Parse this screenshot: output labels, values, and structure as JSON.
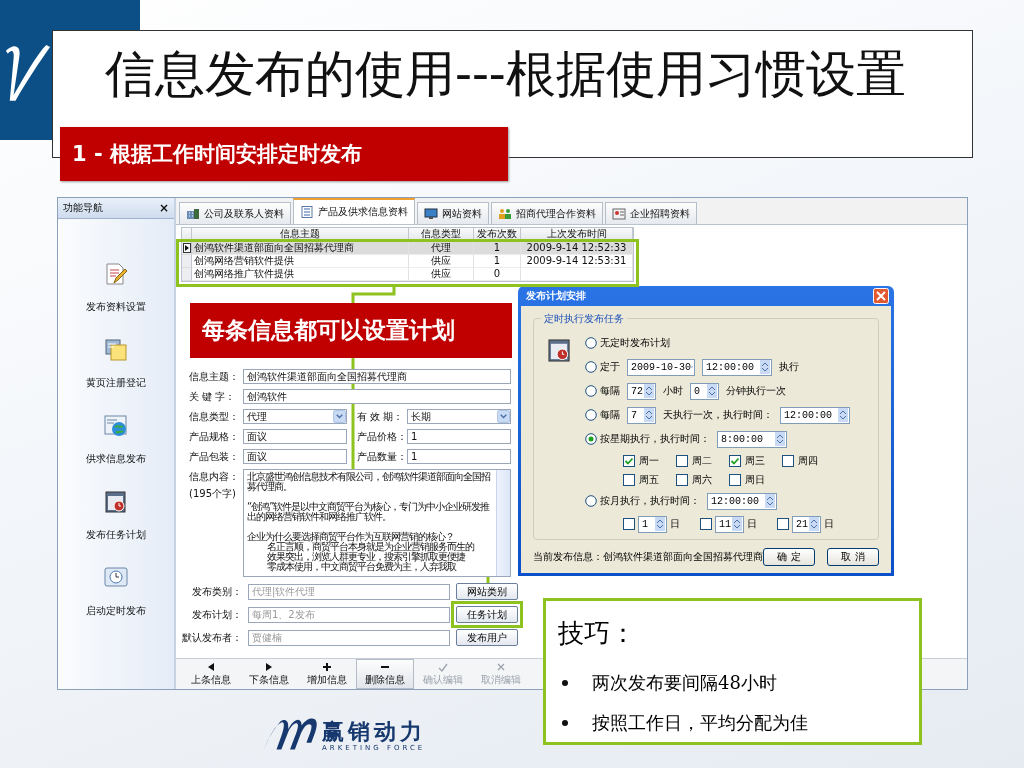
{
  "slide": {
    "title": "信息发布的使用---根据使用习惯设置",
    "section": "1 - 根据工作时间安排定时发布",
    "callout": "每条信息都可以设置计划",
    "tips": {
      "heading": "技巧：",
      "items": [
        "两次发布要间隔48小时",
        "按照工作日，平均分配为佳"
      ]
    },
    "logo": {
      "name": "赢销动力",
      "tagline": "ARKETING FORCE"
    }
  },
  "app": {
    "nav": {
      "title": "功能导航",
      "close": "×",
      "items": [
        {
          "label": "发布资料设置"
        },
        {
          "label": "黄页注册登记"
        },
        {
          "label": "供求信息发布"
        },
        {
          "label": "发布任务计划"
        },
        {
          "label": "启动定时发布"
        }
      ]
    },
    "tabs": [
      {
        "label": "公司及联系人资料",
        "selected": false
      },
      {
        "label": "产品及供求信息资料",
        "selected": true
      },
      {
        "label": "网站资料",
        "selected": false
      },
      {
        "label": "招商代理合作资料",
        "selected": false
      },
      {
        "label": "企业招聘资料",
        "selected": false
      }
    ],
    "table": {
      "columns": [
        "信息主题",
        "信息类型",
        "发布次数",
        "上次发布时间"
      ],
      "rows": [
        {
          "cells": [
            "创鸿软件渠道部面向全国招募代理商",
            "代理",
            "1",
            "2009-9-14 12:52:33"
          ],
          "selected": true
        },
        {
          "cells": [
            "创鸿网络营销软件提供",
            "供应",
            "1",
            "2009-9-14 12:53:31"
          ],
          "selected": false
        },
        {
          "cells": [
            "创鸿网络推广软件提供",
            "供应",
            "0"
          ],
          "selected": false
        }
      ]
    },
    "form": {
      "fields": [
        {
          "kind": "wide",
          "label": "信息主题：",
          "value": "创鸿软件渠道部面向全国招募代理商"
        },
        {
          "kind": "wide",
          "label": "关 键 字：",
          "value": "创鸿软件"
        },
        {
          "kind": "select",
          "label": "信息类型：",
          "value": "代理"
        },
        {
          "kind": "select",
          "label": "有 效 期：",
          "value": "长期"
        },
        {
          "kind": "half",
          "label": "产品规格：",
          "value": "面议"
        },
        {
          "kind": "half",
          "label": "产品价格：",
          "value": "1"
        },
        {
          "kind": "half",
          "label": "产品包装：",
          "value": "面议"
        },
        {
          "kind": "half",
          "label": "产品数量：",
          "value": "1"
        }
      ],
      "content": {
        "label": "信息内容：",
        "count": "(195个字)",
        "blocks": [
          [
            {
              "text": "北京盛世鸿创信息技术有限公司，创鸿软件渠道部面向全国招募代理商。",
              "indent": false
            }
          ],
          [
            {
              "text": "“创鸿”软件是以中文商贸平台为核心，专门为中小企业研发推出的网络营销软件和网络推广软件。",
              "indent": false
            }
          ],
          [
            {
              "text": "企业为什么要选择商贸平台作为互联网营销的核心？",
              "indent": false
            },
            {
              "text": "名正言顺，商贸平台本身就是为企业营销服务而生的",
              "indent": true
            },
            {
              "text": "效果突出，浏览人群更专业，搜索引擎抓取更便捷",
              "indent": true
            },
            {
              "text": "零成本使用，中文商贸平台免费为主，人弃我取",
              "indent": true
            }
          ]
        ]
      },
      "publish": [
        {
          "label": "发布类别：",
          "placeholder": "代理|软件代理",
          "button": "网站类别",
          "highlighted": false
        },
        {
          "label": "发布计划：",
          "placeholder": "每周1、2发布",
          "button": "任务计划",
          "highlighted": true
        },
        {
          "label": "默认发布者：",
          "placeholder": "贾健楠",
          "button": "发布用户",
          "highlighted": false
        }
      ]
    },
    "toolbar": [
      {
        "kind": "prev",
        "label": "上条信息",
        "pressed": false,
        "disabled": false
      },
      {
        "kind": "next",
        "label": "下条信息",
        "pressed": false,
        "disabled": false
      },
      {
        "kind": "add",
        "label": "增加信息",
        "pressed": false,
        "disabled": false
      },
      {
        "kind": "delete",
        "label": "删除信息",
        "pressed": true,
        "disabled": false
      },
      {
        "kind": "confirm",
        "label": "确认编辑",
        "pressed": false,
        "disabled": true
      },
      {
        "kind": "cancel",
        "label": "取消编辑",
        "pressed": false,
        "disabled": true
      }
    ]
  },
  "dialog": {
    "title": "发布计划安排",
    "group": "定时执行发布任务",
    "options": [
      {
        "selected": false,
        "parts": [
          {
            "kind": "text",
            "text": "无定时发布计划"
          }
        ]
      },
      {
        "selected": false,
        "parts": [
          {
            "kind": "text",
            "text": "定于"
          },
          {
            "kind": "date",
            "value": "2009-10-30"
          },
          {
            "kind": "time",
            "value": "12:00:00"
          },
          {
            "kind": "text",
            "text": "执行"
          }
        ]
      },
      {
        "selected": false,
        "parts": [
          {
            "kind": "text",
            "text": "每隔"
          },
          {
            "kind": "number",
            "value": "72"
          },
          {
            "kind": "text",
            "text": "小时"
          },
          {
            "kind": "number",
            "value": "0"
          },
          {
            "kind": "text",
            "text": "分钟执行一次"
          }
        ]
      },
      {
        "selected": false,
        "parts": [
          {
            "kind": "text",
            "text": "每隔"
          },
          {
            "kind": "number",
            "value": "7"
          },
          {
            "kind": "text",
            "text": "天执行一次，执行时间："
          },
          {
            "kind": "time",
            "value": "12:00:00"
          }
        ]
      },
      {
        "selected": true,
        "parts": [
          {
            "kind": "text",
            "text": "按星期执行，执行时间："
          },
          {
            "kind": "time",
            "value": "8:00:00"
          }
        ],
        "sub_rows": [
          [
            {
              "kind": "check",
              "label": "周一",
              "checked": true
            },
            {
              "kind": "check",
              "label": "周二",
              "checked": false
            },
            {
              "kind": "check",
              "label": "周三",
              "checked": true
            },
            {
              "kind": "check",
              "label": "周四",
              "checked": false
            }
          ],
          [
            {
              "kind": "check",
              "label": "周五",
              "checked": false
            },
            {
              "kind": "check",
              "label": "周六",
              "checked": false
            },
            {
              "kind": "check",
              "label": "周日",
              "checked": false
            }
          ]
        ]
      },
      {
        "selected": false,
        "parts": [
          {
            "kind": "text",
            "text": "按月执行，执行时间："
          },
          {
            "kind": "time",
            "value": "12:00:00"
          }
        ],
        "sub_rows": [
          [
            {
              "kind": "check-spin",
              "value": "1",
              "unit": "日",
              "checked": false
            },
            {
              "kind": "check-spin",
              "value": "11",
              "unit": "日",
              "checked": false
            },
            {
              "kind": "check-spin",
              "value": "21",
              "unit": "日",
              "checked": false
            }
          ]
        ]
      }
    ],
    "current": "当前发布信息：创鸿软件渠道部面向全国招募代理商",
    "buttons": [
      "确 定",
      "取 消"
    ]
  }
}
